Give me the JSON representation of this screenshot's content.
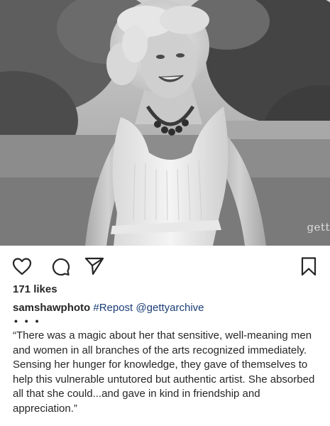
{
  "post": {
    "image_watermark": "gett",
    "likes": "171 likes",
    "username": "samshawphoto",
    "hashtag": "#Repost",
    "mention": "@gettyarchive",
    "more": "• • •",
    "quote": "“There was a magic about her that sensitive, well-meaning men and women in all branches of the arts recognized immediately. Sensing her hunger for knowledge, they gave of themselves to help this vulnerable untutored but authentic artist. She absorbed all that she could...and gave in kind in friendship and appreciation.”"
  },
  "icons": {
    "like": "heart-icon",
    "comment": "comment-icon",
    "share": "paper-plane-icon",
    "save": "bookmark-icon"
  },
  "colors": {
    "text": "#262626",
    "link": "#1b3e76",
    "background": "#ffffff"
  }
}
